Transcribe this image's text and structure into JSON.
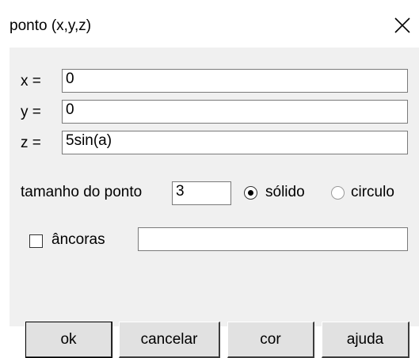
{
  "dialog": {
    "title": "ponto (x,y,z)",
    "x_label": "x =",
    "x_value": "0",
    "y_label": "y =",
    "y_value": "0",
    "z_label": "z =",
    "z_value": "5sin(a)",
    "size_label": "tamanho do ponto",
    "size_value": "3",
    "style_options": [
      {
        "label": "sólido",
        "selected": true
      },
      {
        "label": "circulo",
        "selected": false
      }
    ],
    "anchors_label": "âncoras",
    "anchors_checked": false,
    "anchors_value": "",
    "buttons": {
      "ok": "ok",
      "cancel": "cancelar",
      "color": "cor",
      "help": "ajuda"
    }
  }
}
